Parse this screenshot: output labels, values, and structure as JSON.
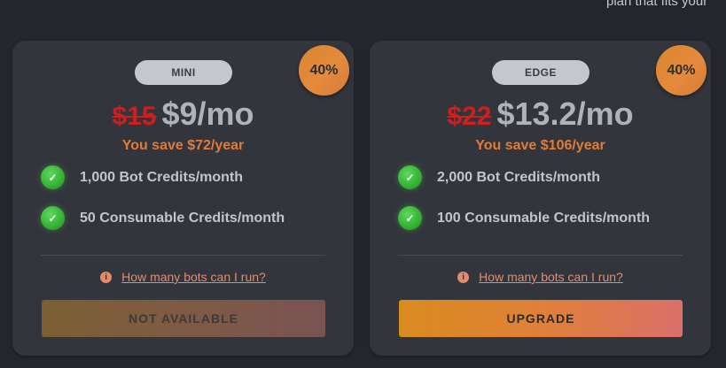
{
  "header": {
    "text": "plan that fits your"
  },
  "plans": [
    {
      "name": "MINI",
      "discount": "40%",
      "old_price": "$15",
      "new_price": "$9/mo",
      "savings": "You save $72/year",
      "features": [
        "1,000 Bot Credits/month",
        "50 Consumable Credits/month"
      ],
      "info_link": "How many bots can I run?",
      "button_label": "NOT AVAILABLE",
      "button_state": "disabled"
    },
    {
      "name": "EDGE",
      "discount": "40%",
      "old_price": "$22",
      "new_price": "$13.2/mo",
      "savings": "You save $106/year",
      "features": [
        "2,000 Bot Credits/month",
        "100 Consumable Credits/month"
      ],
      "info_link": "How many bots can I run?",
      "button_label": "UPGRADE",
      "button_state": "enabled"
    }
  ],
  "icons": {
    "check": "check-circle-icon",
    "info": "info-icon"
  },
  "colors": {
    "background": "#25262c",
    "card": "#33353c",
    "old_price": "#cc1f1f",
    "savings": "#e07b39",
    "check": "#36b536",
    "accent": "#e08038"
  }
}
